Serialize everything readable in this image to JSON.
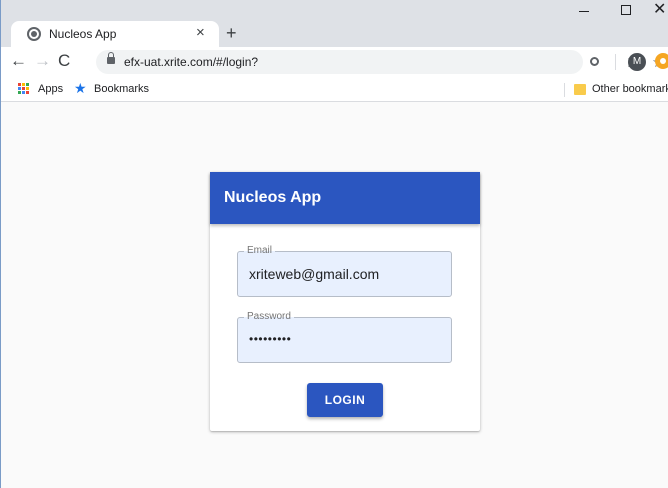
{
  "browser": {
    "tab_title": "Nucleos App",
    "tab_close_glyph": "×",
    "new_tab_glyph": "+",
    "url": "efx-uat.xrite.com/#/login?",
    "profile_initial": "M",
    "nav": {
      "back": "←",
      "forward": "→",
      "reload": "C"
    },
    "window_close_glyph": "✕",
    "bookmarks": {
      "apps_label": "Apps",
      "bookmarks_label": "Bookmarks",
      "other_label": "Other bookmarks"
    }
  },
  "login": {
    "header_title": "Nucleos App",
    "email": {
      "label": "Email",
      "value": "xriteweb@gmail.com"
    },
    "password": {
      "label": "Password",
      "masked_value": "•••••••••"
    },
    "submit_label": "LOGIN"
  },
  "colors": {
    "primary": "#2b56c0",
    "autofill_bg": "#e8f0fe",
    "page_bg": "#fafafa",
    "bookmark_star": "#1a73e8",
    "folder": "#f9cb4b"
  },
  "icons": {
    "tab_favicon": "globe-icon",
    "lock": "lock-icon",
    "key": "key-icon",
    "star": "star-icon",
    "extension": "extension-icon",
    "apps": "apps-grid-icon",
    "folder": "folder-icon"
  }
}
